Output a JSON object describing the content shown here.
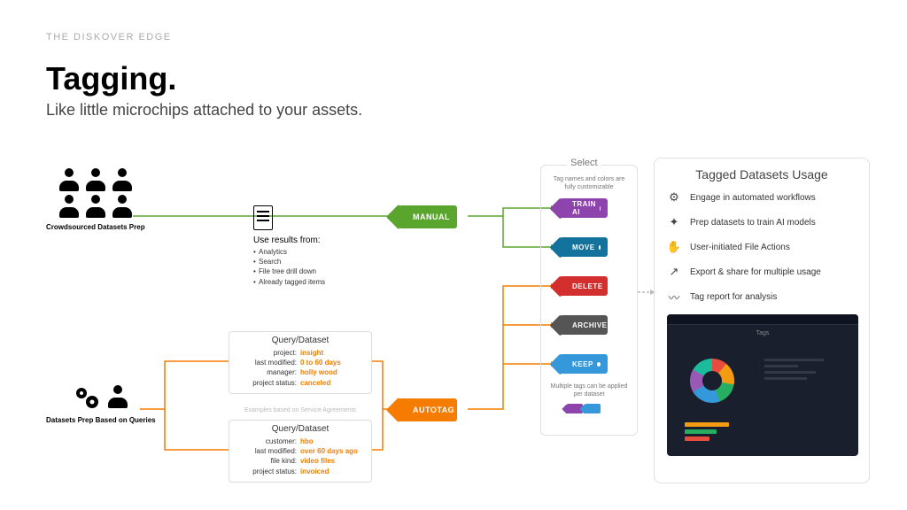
{
  "eyebrow": "THE DISKOVER EDGE",
  "title": "Tagging",
  "subtitle": "Like little microchips attached to your assets.",
  "crowd_label": "Crowdsourced Datasets Prep",
  "queries_label": "Datasets Prep Based on Queries",
  "use_results": {
    "lead": "Use results from:",
    "items": [
      "Analytics",
      "Search",
      "File tree drill down",
      "Already tagged items"
    ]
  },
  "qbox1": {
    "title": "Query/Dataset",
    "rows": [
      {
        "k": "project:",
        "v": "insight"
      },
      {
        "k": "last modified:",
        "v": "0 to 60 days"
      },
      {
        "k": "manager:",
        "v": "holly wood"
      },
      {
        "k": "project status:",
        "v": "canceled"
      }
    ]
  },
  "qnote": "Examples based on Service Agreements",
  "qbox2": {
    "title": "Query/Dataset",
    "rows": [
      {
        "k": "customer:",
        "v": "hbo"
      },
      {
        "k": "last modified:",
        "v": "over 60 days ago"
      },
      {
        "k": "file kind:",
        "v": "video files"
      },
      {
        "k": "project status:",
        "v": "invoiced"
      }
    ]
  },
  "tags": {
    "manual": "MANUAL",
    "autotag": "AUTOTAG",
    "trainai": "TRAIN AI",
    "move": "MOVE",
    "delete": "DELETE",
    "archive": "ARCHIVE",
    "keep": "KEEP"
  },
  "select": {
    "label": "Select",
    "note_top": "Tag names and colors are fully customizable",
    "note_bottom": "Multiple tags can be applied per dataset"
  },
  "usage": {
    "title": "Tagged Datasets Usage",
    "items": [
      "Engage in automated workflows",
      "Prep datasets to train AI models",
      "User-initiated File Actions",
      "Export & share for multiple usage",
      "Tag report for analysis"
    ],
    "screenshot_label": "Tags"
  },
  "colors": {
    "green": "#5aa52e",
    "orange": "#f57c00",
    "purple": "#8e44ad",
    "darkblue": "#14739c",
    "red": "#d32f2f",
    "gray": "#555",
    "blue": "#3498db"
  }
}
